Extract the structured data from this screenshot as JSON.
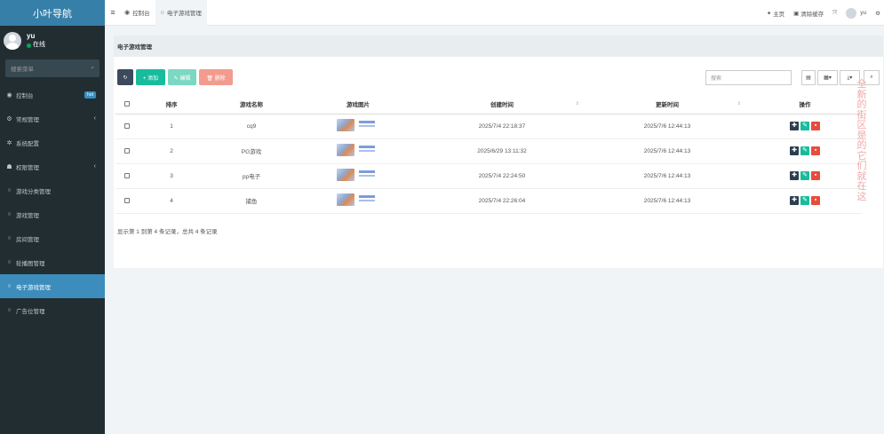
{
  "sidebar": {
    "logo": "小叶导航",
    "user": {
      "name": "yu",
      "status": "在线"
    },
    "search_placeholder": "搜索菜单",
    "items": [
      {
        "label": "控制台",
        "icon": "dashboard-icon",
        "glyph": "◉",
        "badge": "hot"
      },
      {
        "label": "常规管理",
        "icon": "cogs-icon",
        "glyph": "⚙",
        "chevron": "‹"
      },
      {
        "label": "系统配置",
        "icon": "gear-icon",
        "glyph": "✲"
      },
      {
        "label": "权限管理",
        "icon": "users-icon",
        "glyph": "☗",
        "chevron": "‹"
      },
      {
        "label": "游戏分类管理",
        "icon": "circle-icon",
        "glyph": "○"
      },
      {
        "label": "游戏管理",
        "icon": "circle-icon",
        "glyph": "○"
      },
      {
        "label": "房间管理",
        "icon": "circle-icon",
        "glyph": "○"
      },
      {
        "label": "轮播图管理",
        "icon": "circle-icon",
        "glyph": "○"
      },
      {
        "label": "电子游戏管理",
        "icon": "circle-icon",
        "glyph": "○",
        "active": true
      },
      {
        "label": "广告位管理",
        "icon": "circle-icon",
        "glyph": "○"
      }
    ]
  },
  "header": {
    "menu_icon": "≡",
    "tabs": [
      {
        "label": "控制台",
        "icon": "dashboard-icon",
        "glyph": "◉"
      },
      {
        "label": "电子游戏管理",
        "icon": "circle-icon",
        "glyph": "○",
        "active": true
      }
    ],
    "right": {
      "home": "主页",
      "home_glyph": "✦",
      "clear_cache": "清除缓存",
      "clear_glyph": "▣",
      "fullscreen_glyph": "⤧",
      "user": "yu",
      "settings_glyph": "⚙"
    }
  },
  "panel": {
    "title": "电子游戏管理",
    "toolbar": {
      "refresh": "↻",
      "add": "+ 添加",
      "edit": "✎ 编辑",
      "delete": "🗑 删除",
      "search_placeholder": "搜索",
      "view_toggle": "▤",
      "columns": "▦▾",
      "export": "⤓▾",
      "search_btn": "⌕"
    },
    "table": {
      "headers": [
        "",
        "排序",
        "游戏名称",
        "游戏图片",
        "创建时间",
        "更新时间",
        "操作"
      ],
      "rows": [
        {
          "sort": "1",
          "name": "cq9",
          "created": "2025/7/4 22:18:37",
          "updated": "2025/7/6 12:44:13"
        },
        {
          "sort": "2",
          "name": "PG游戏",
          "created": "2025/6/29 13:11:32",
          "updated": "2025/7/6 12:44:13"
        },
        {
          "sort": "3",
          "name": "pp电子",
          "created": "2025/7/4 22:24:50",
          "updated": "2025/7/6 12:44:13"
        },
        {
          "sort": "4",
          "name": "捕鱼",
          "created": "2025/7/4 22:26:04",
          "updated": "2025/7/6 12:44:13"
        }
      ],
      "ops": {
        "drag": "✚",
        "edit": "✎",
        "delete": "▪"
      }
    },
    "footer": "显示第 1 到第 4 条记录，总共 4 条记录"
  },
  "watermark": "全新的街区是的它们就在这",
  "colors": {
    "sidebar_bg": "#222d32",
    "logo_bg": "#367fa9",
    "active": "#3c8dbc",
    "add": "#18bc9c",
    "delete": "#e74c3c"
  }
}
